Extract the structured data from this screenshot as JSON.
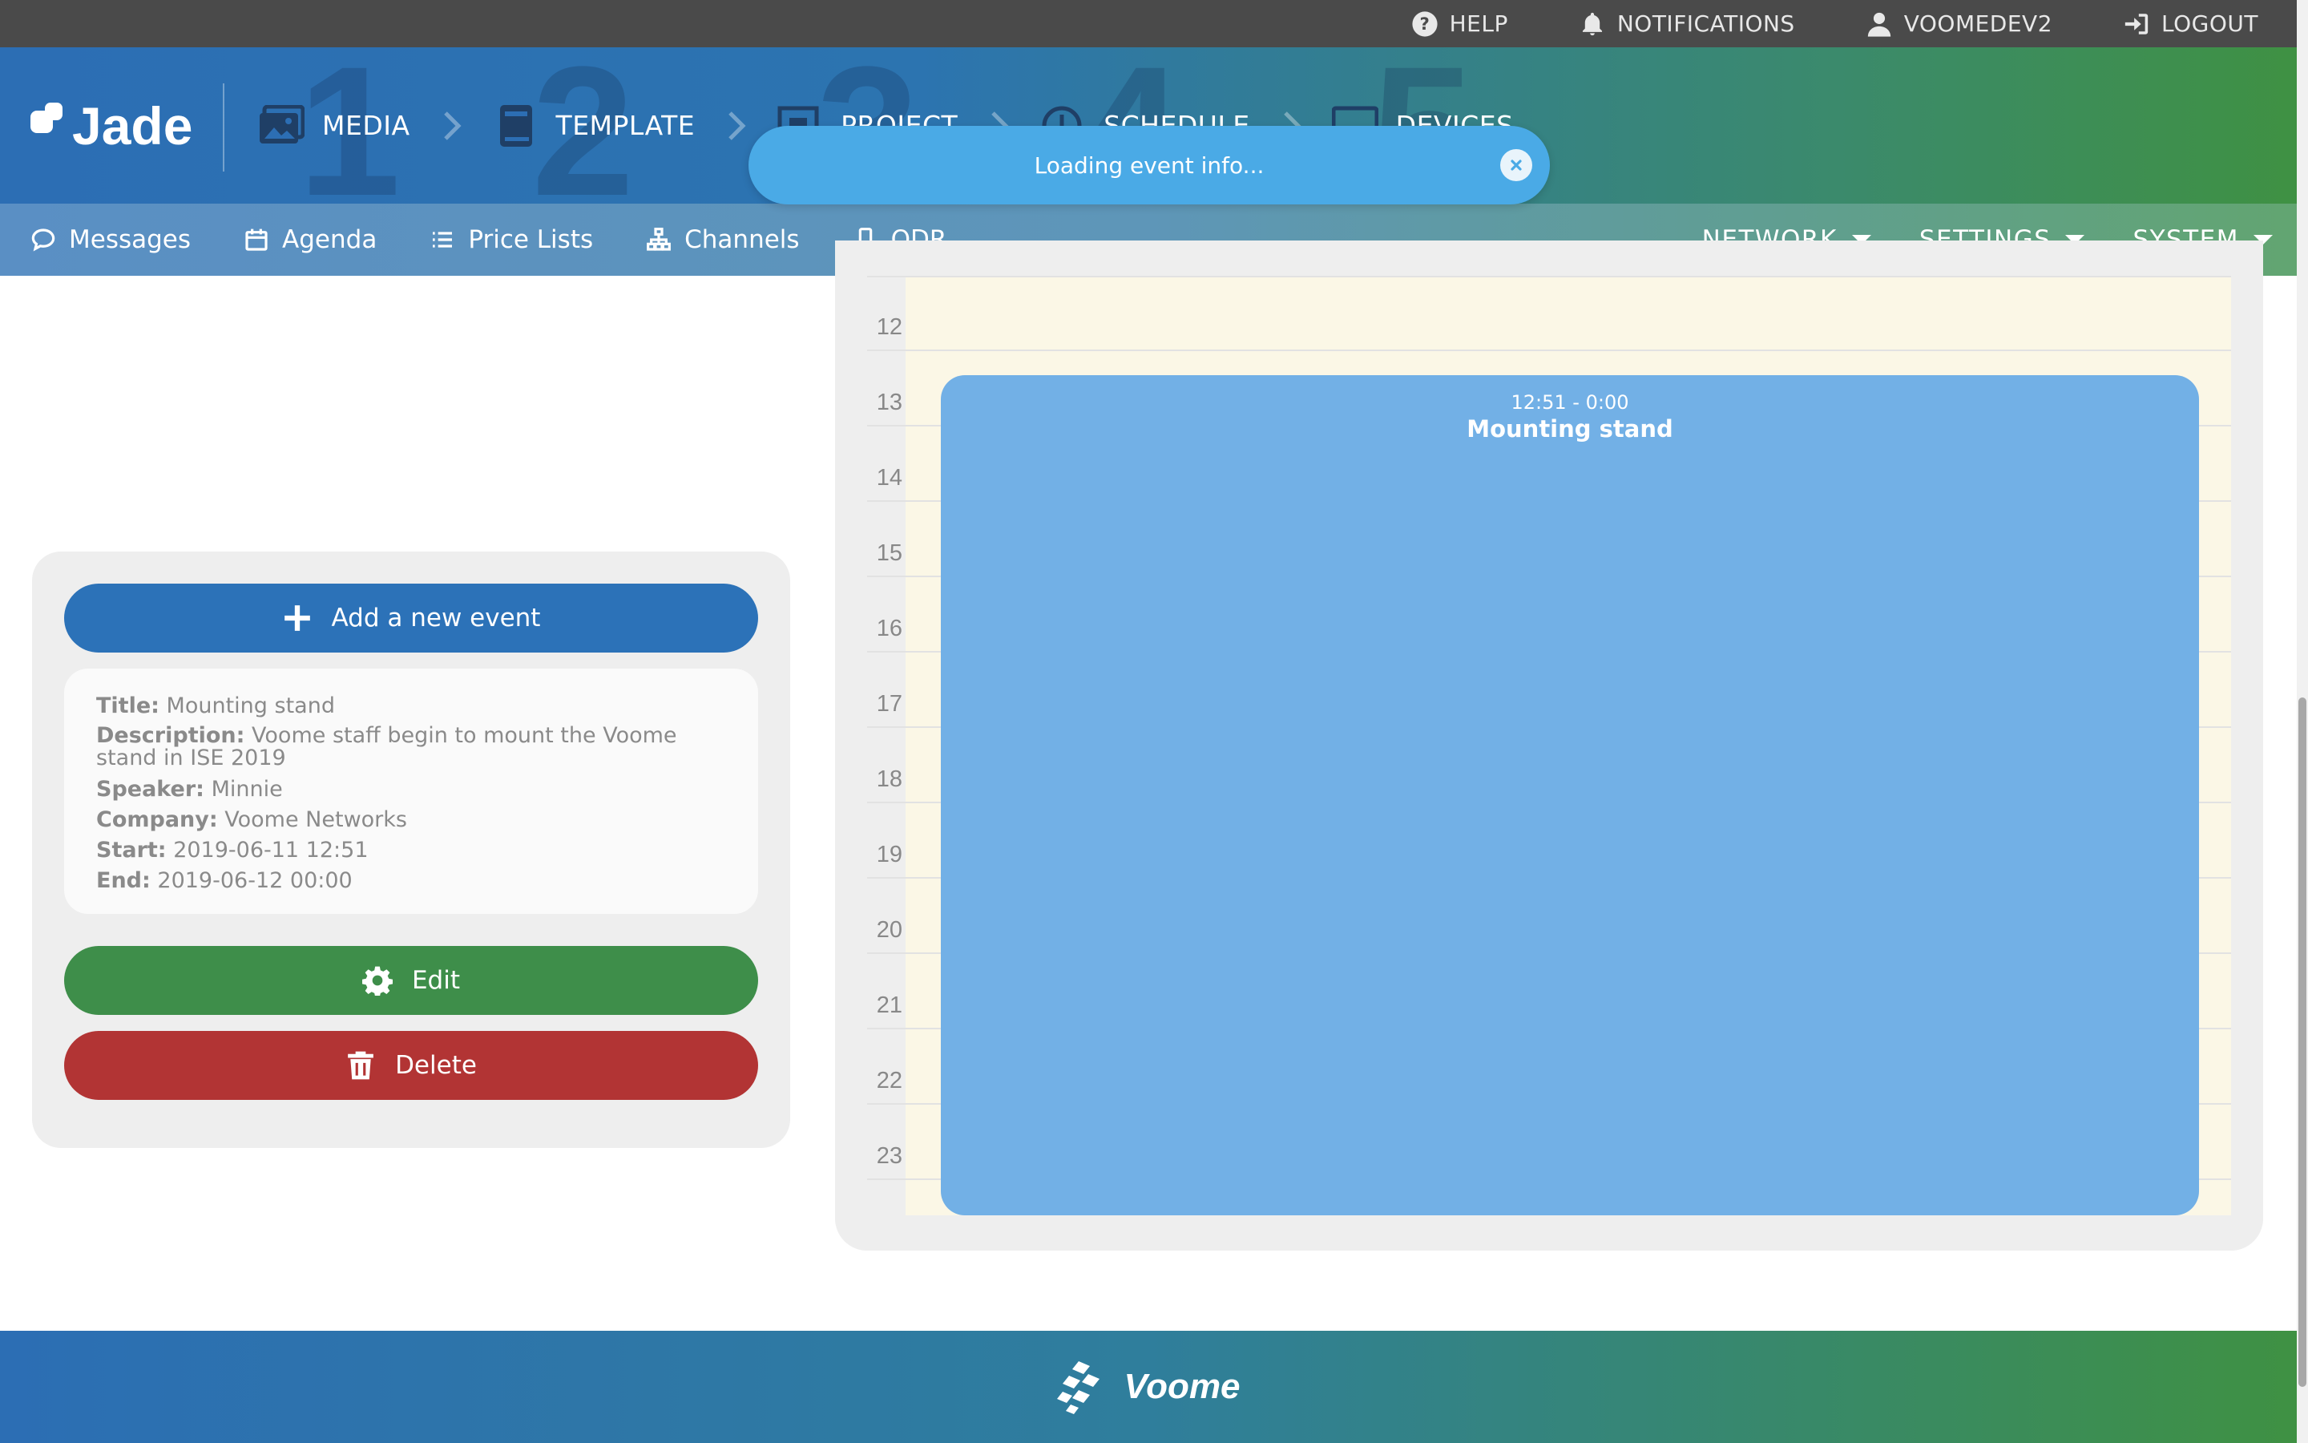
{
  "utility_bar": {
    "help": "HELP",
    "notifications": "NOTIFICATIONS",
    "user": "VOOMEDEV2",
    "logout": "LOGOUT"
  },
  "header": {
    "logo": "Jade",
    "steps": [
      {
        "num": "1",
        "label": "MEDIA",
        "icon": "image-icon"
      },
      {
        "num": "2",
        "label": "TEMPLATE",
        "icon": "book-icon"
      },
      {
        "num": "3",
        "label": "PROJECT",
        "icon": "project-icon"
      },
      {
        "num": "4",
        "label": "SCHEDULE",
        "icon": "clock-icon"
      },
      {
        "num": "5",
        "label": "DEVICES",
        "icon": "monitor-icon"
      }
    ]
  },
  "sub_nav": {
    "items": [
      "Messages",
      "Agenda",
      "Price Lists",
      "Channels",
      "ODR"
    ],
    "dropdowns": [
      "NETWORK",
      "SETTINGS",
      "SYSTEM"
    ]
  },
  "toast": {
    "message": "Loading event info..."
  },
  "event_panel": {
    "add_label": "Add a new event",
    "title_label": "Title:",
    "title_value": "Mounting stand",
    "description_label": "Description:",
    "description_value": "Voome staff begin to mount the Voome stand in ISE 2019",
    "speaker_label": "Speaker:",
    "speaker_value": "Minnie",
    "company_label": "Company:",
    "company_value": "Voome Networks",
    "start_label": "Start:",
    "start_value": "2019-06-11 12:51",
    "end_label": "End:",
    "end_value": "2019-06-12 00:00",
    "edit_label": "Edit",
    "delete_label": "Delete"
  },
  "calendar": {
    "hours": [
      "12",
      "13",
      "14",
      "15",
      "16",
      "17",
      "18",
      "19",
      "20",
      "21",
      "22",
      "23"
    ],
    "event": {
      "time": "12:51 - 0:00",
      "title": "Mounting stand",
      "color": "#72b0e6"
    }
  },
  "footer": {
    "brand": "Voome"
  },
  "colors": {
    "primary_blue": "#2c72b8",
    "success_green": "#3e8e4a",
    "danger_red": "#b23434",
    "toast_blue": "#4aaae6"
  }
}
